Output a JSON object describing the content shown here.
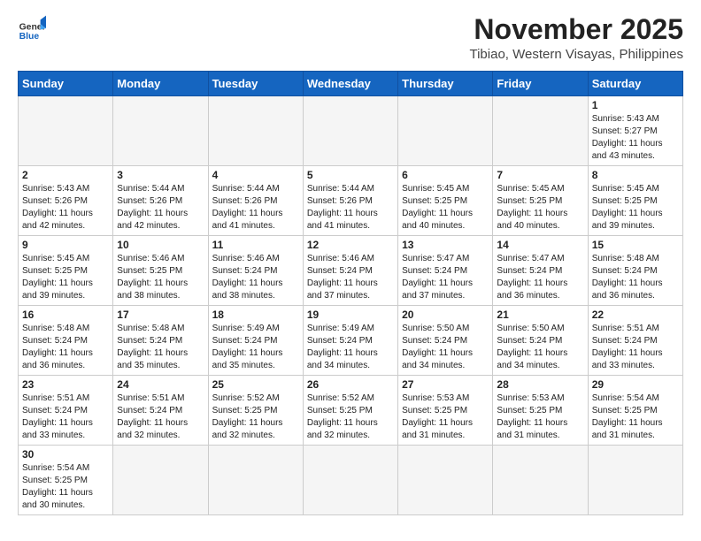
{
  "header": {
    "logo_general": "General",
    "logo_blue": "Blue",
    "month_title": "November 2025",
    "location": "Tibiao, Western Visayas, Philippines"
  },
  "weekdays": [
    "Sunday",
    "Monday",
    "Tuesday",
    "Wednesday",
    "Thursday",
    "Friday",
    "Saturday"
  ],
  "weeks": [
    [
      {
        "day": "",
        "info": ""
      },
      {
        "day": "",
        "info": ""
      },
      {
        "day": "",
        "info": ""
      },
      {
        "day": "",
        "info": ""
      },
      {
        "day": "",
        "info": ""
      },
      {
        "day": "",
        "info": ""
      },
      {
        "day": "1",
        "info": "Sunrise: 5:43 AM\nSunset: 5:27 PM\nDaylight: 11 hours\nand 43 minutes."
      }
    ],
    [
      {
        "day": "2",
        "info": "Sunrise: 5:43 AM\nSunset: 5:26 PM\nDaylight: 11 hours\nand 42 minutes."
      },
      {
        "day": "3",
        "info": "Sunrise: 5:44 AM\nSunset: 5:26 PM\nDaylight: 11 hours\nand 42 minutes."
      },
      {
        "day": "4",
        "info": "Sunrise: 5:44 AM\nSunset: 5:26 PM\nDaylight: 11 hours\nand 41 minutes."
      },
      {
        "day": "5",
        "info": "Sunrise: 5:44 AM\nSunset: 5:26 PM\nDaylight: 11 hours\nand 41 minutes."
      },
      {
        "day": "6",
        "info": "Sunrise: 5:45 AM\nSunset: 5:25 PM\nDaylight: 11 hours\nand 40 minutes."
      },
      {
        "day": "7",
        "info": "Sunrise: 5:45 AM\nSunset: 5:25 PM\nDaylight: 11 hours\nand 40 minutes."
      },
      {
        "day": "8",
        "info": "Sunrise: 5:45 AM\nSunset: 5:25 PM\nDaylight: 11 hours\nand 39 minutes."
      }
    ],
    [
      {
        "day": "9",
        "info": "Sunrise: 5:45 AM\nSunset: 5:25 PM\nDaylight: 11 hours\nand 39 minutes."
      },
      {
        "day": "10",
        "info": "Sunrise: 5:46 AM\nSunset: 5:25 PM\nDaylight: 11 hours\nand 38 minutes."
      },
      {
        "day": "11",
        "info": "Sunrise: 5:46 AM\nSunset: 5:24 PM\nDaylight: 11 hours\nand 38 minutes."
      },
      {
        "day": "12",
        "info": "Sunrise: 5:46 AM\nSunset: 5:24 PM\nDaylight: 11 hours\nand 37 minutes."
      },
      {
        "day": "13",
        "info": "Sunrise: 5:47 AM\nSunset: 5:24 PM\nDaylight: 11 hours\nand 37 minutes."
      },
      {
        "day": "14",
        "info": "Sunrise: 5:47 AM\nSunset: 5:24 PM\nDaylight: 11 hours\nand 36 minutes."
      },
      {
        "day": "15",
        "info": "Sunrise: 5:48 AM\nSunset: 5:24 PM\nDaylight: 11 hours\nand 36 minutes."
      }
    ],
    [
      {
        "day": "16",
        "info": "Sunrise: 5:48 AM\nSunset: 5:24 PM\nDaylight: 11 hours\nand 36 minutes."
      },
      {
        "day": "17",
        "info": "Sunrise: 5:48 AM\nSunset: 5:24 PM\nDaylight: 11 hours\nand 35 minutes."
      },
      {
        "day": "18",
        "info": "Sunrise: 5:49 AM\nSunset: 5:24 PM\nDaylight: 11 hours\nand 35 minutes."
      },
      {
        "day": "19",
        "info": "Sunrise: 5:49 AM\nSunset: 5:24 PM\nDaylight: 11 hours\nand 34 minutes."
      },
      {
        "day": "20",
        "info": "Sunrise: 5:50 AM\nSunset: 5:24 PM\nDaylight: 11 hours\nand 34 minutes."
      },
      {
        "day": "21",
        "info": "Sunrise: 5:50 AM\nSunset: 5:24 PM\nDaylight: 11 hours\nand 34 minutes."
      },
      {
        "day": "22",
        "info": "Sunrise: 5:51 AM\nSunset: 5:24 PM\nDaylight: 11 hours\nand 33 minutes."
      }
    ],
    [
      {
        "day": "23",
        "info": "Sunrise: 5:51 AM\nSunset: 5:24 PM\nDaylight: 11 hours\nand 33 minutes."
      },
      {
        "day": "24",
        "info": "Sunrise: 5:51 AM\nSunset: 5:24 PM\nDaylight: 11 hours\nand 32 minutes."
      },
      {
        "day": "25",
        "info": "Sunrise: 5:52 AM\nSunset: 5:25 PM\nDaylight: 11 hours\nand 32 minutes."
      },
      {
        "day": "26",
        "info": "Sunrise: 5:52 AM\nSunset: 5:25 PM\nDaylight: 11 hours\nand 32 minutes."
      },
      {
        "day": "27",
        "info": "Sunrise: 5:53 AM\nSunset: 5:25 PM\nDaylight: 11 hours\nand 31 minutes."
      },
      {
        "day": "28",
        "info": "Sunrise: 5:53 AM\nSunset: 5:25 PM\nDaylight: 11 hours\nand 31 minutes."
      },
      {
        "day": "29",
        "info": "Sunrise: 5:54 AM\nSunset: 5:25 PM\nDaylight: 11 hours\nand 31 minutes."
      }
    ],
    [
      {
        "day": "30",
        "info": "Sunrise: 5:54 AM\nSunset: 5:25 PM\nDaylight: 11 hours\nand 30 minutes."
      },
      {
        "day": "",
        "info": ""
      },
      {
        "day": "",
        "info": ""
      },
      {
        "day": "",
        "info": ""
      },
      {
        "day": "",
        "info": ""
      },
      {
        "day": "",
        "info": ""
      },
      {
        "day": "",
        "info": ""
      }
    ]
  ]
}
